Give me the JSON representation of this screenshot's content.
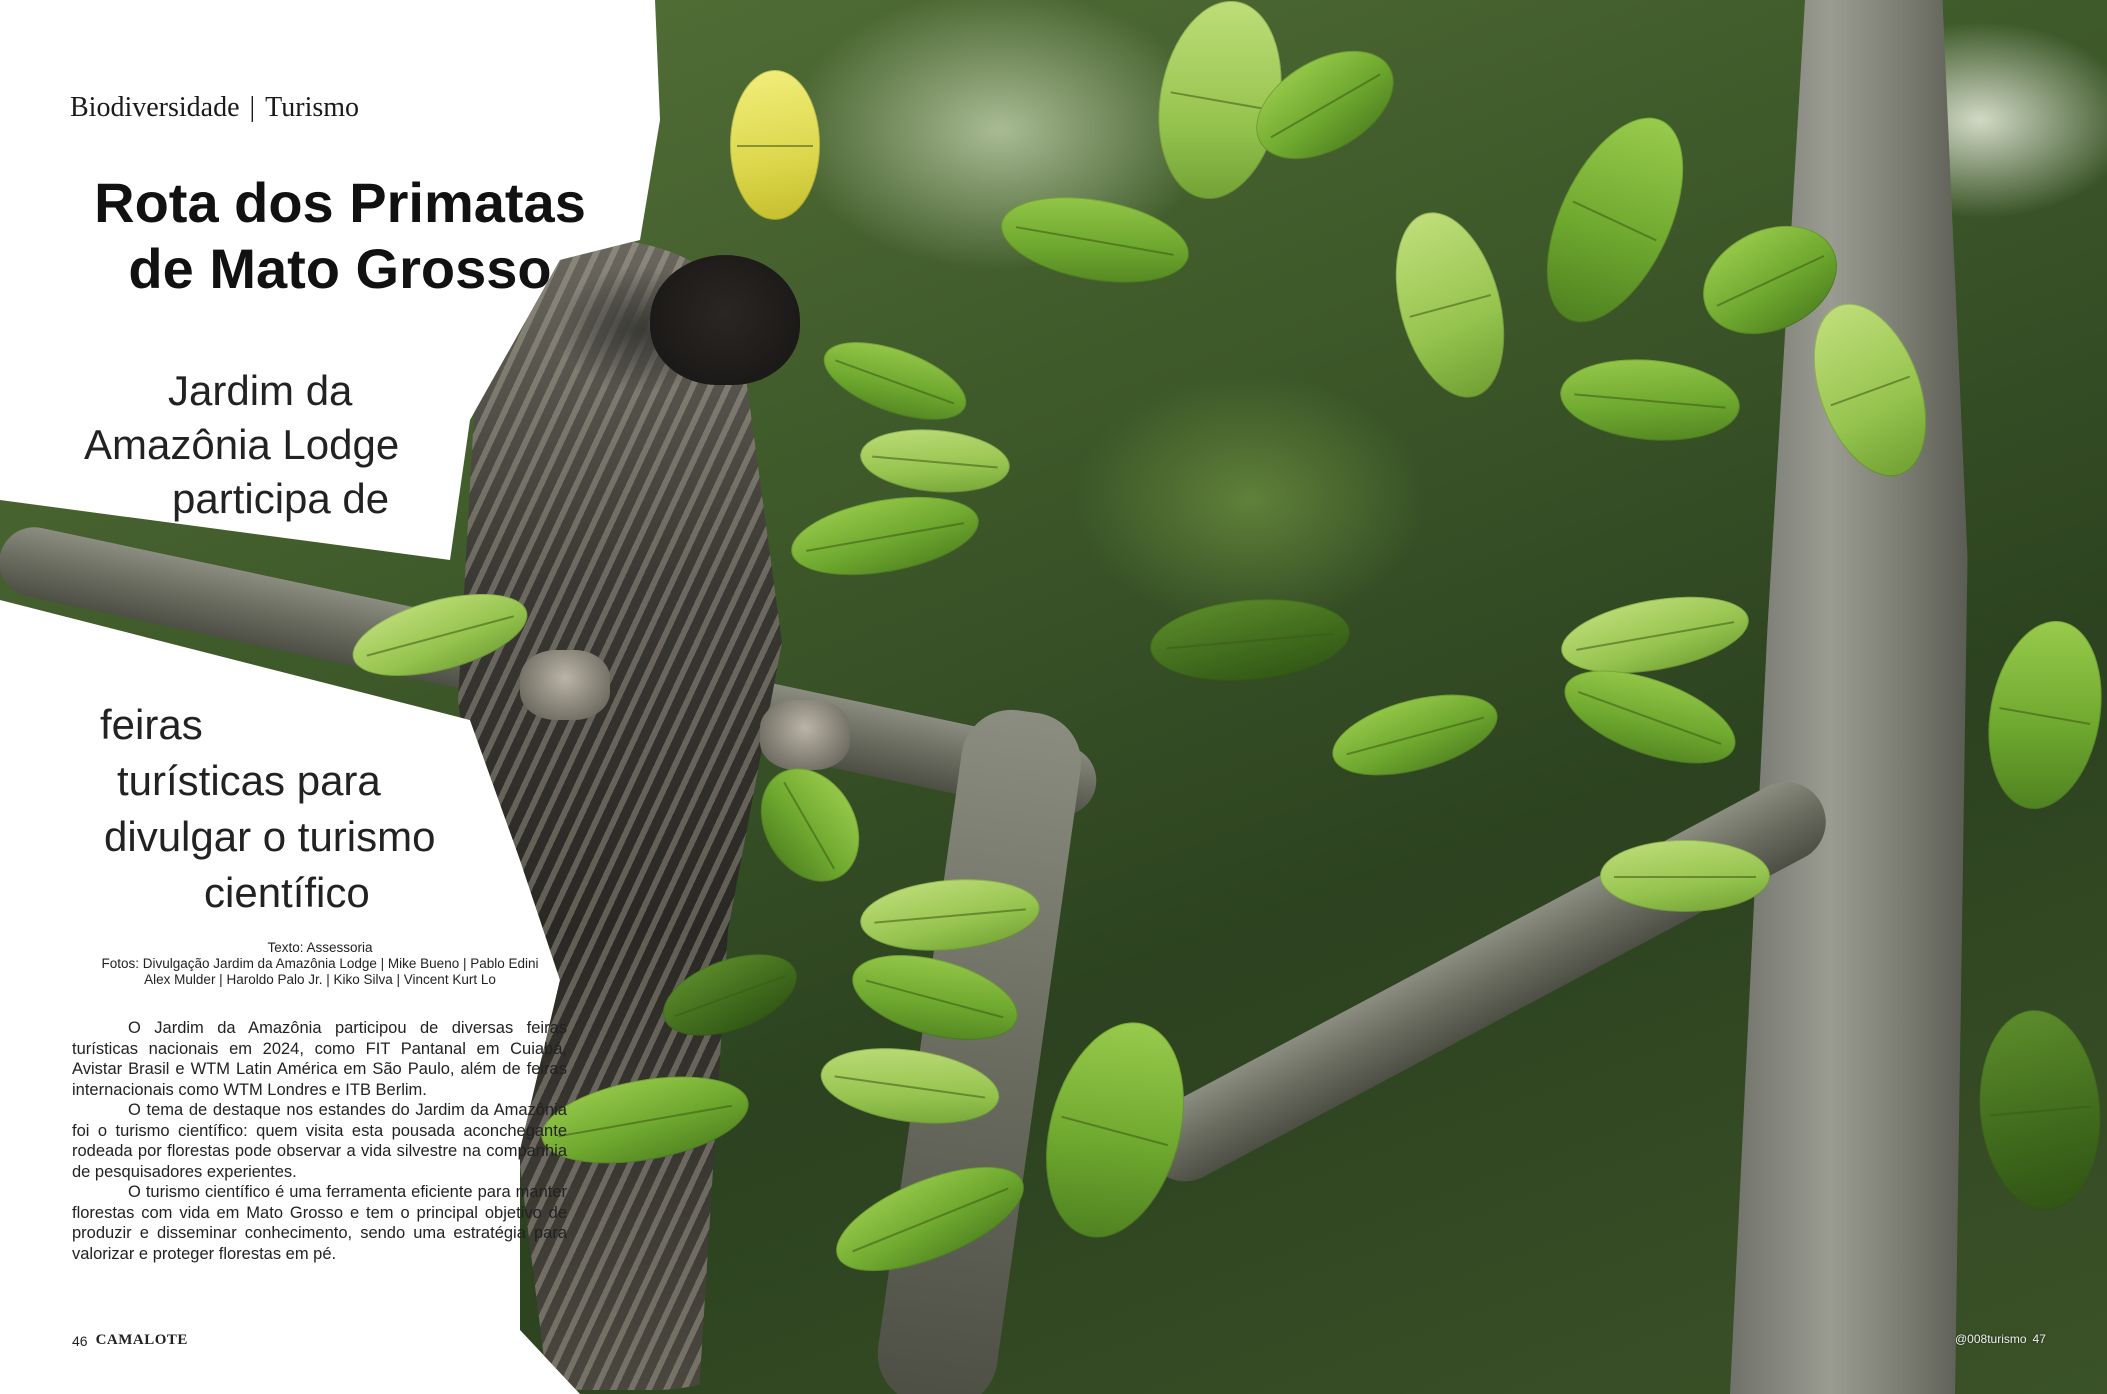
{
  "section": {
    "left": "Biodiversidade",
    "separator": "|",
    "right": "Turismo"
  },
  "headline": {
    "line1": "Rota dos Primatas",
    "line2": "de Mato Grosso"
  },
  "deck": {
    "line1": "Jardim da",
    "line2": "Amazônia Lodge",
    "line3": "participa de",
    "line4": "feiras",
    "line5": "turísticas para",
    "line6": "divulgar o turismo",
    "line7": "científico"
  },
  "credits": {
    "text_label": "Texto:",
    "text_value": "Assessoria",
    "photos_label": "Fotos:",
    "photos_value": "Divulgação Jardim da Amazônia Lodge | Mike Bueno | Pablo Edini",
    "photos_value_2": "Alex Mulder | Haroldo Palo Jr. | Kiko Silva | Vincent Kurt Lo"
  },
  "body": {
    "p1": "O Jardim da Amazônia participou de diversas feiras turísticas nacionais em 2024, como FIT Pantanal em Cuiabá, Avistar Brasil e WTM Latin América em São Paulo, além de feiras internacionais como WTM Londres e ITB Berlim.",
    "p2": "O tema de destaque nos estandes do Jardim da Amazônia foi o turismo científico: quem visita esta pousada aconchegante rodeada por florestas pode observar a vida silvestre na companhia de pesquisadores experientes.",
    "p3": "O turismo científico é uma ferramenta eficiente para manter florestas com vida em Mato Grosso e tem o principal objetivo de produzir e disseminar conhecimento, sendo uma estratégia para valorizar e proteger florestas em pé."
  },
  "footer": {
    "left_page": "46",
    "brand": "CAMALOTE",
    "right_label": "@008turismo",
    "right_page": "47"
  }
}
